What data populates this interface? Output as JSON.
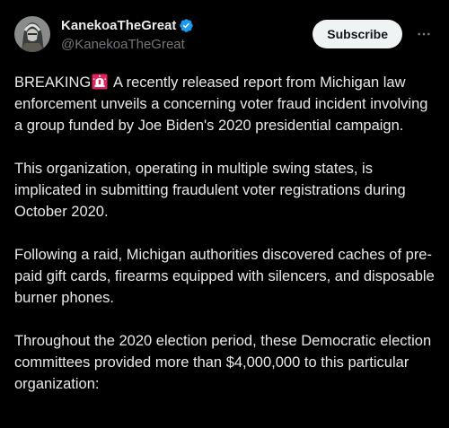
{
  "author": {
    "display_name": "KanekoaTheGreat",
    "handle": "@KanekoaTheGreat",
    "verified_icon": "verified-badge-icon",
    "badge_color": "#1d9bf0"
  },
  "actions": {
    "subscribe_label": "Subscribe",
    "more_icon": "more-options-icon"
  },
  "post": {
    "p1_lead": "BREAKING",
    "p1_emoji": "siren-emoji-icon",
    "p1_rest": " A recently released report from Michigan law enforcement unveils a concerning voter fraud incident involving a group funded by Joe Biden's 2020 presidential campaign.",
    "p2": "This organization, operating in multiple swing states, is implicated in submitting fraudulent voter registrations during October 2020.",
    "p3": "Following a raid, Michigan authorities discovered caches of pre-paid gift cards, firearms equipped with silencers, and disposable burner phones.",
    "p4": "Throughout the 2020 election period, these Democratic election committees provided more than $4,000,000 to this particular organization:"
  },
  "colors": {
    "background": "#000000",
    "text": "#e7e9ea",
    "secondary_text": "#71767b",
    "button_bg": "#eff3f4",
    "button_text": "#0f1419"
  }
}
